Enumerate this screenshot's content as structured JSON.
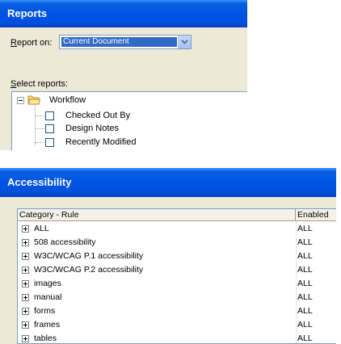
{
  "reports": {
    "title": "Reports",
    "report_on_label_accel": "R",
    "report_on_label_rest": "eport on:",
    "report_on_value": "Current Document",
    "select_reports_label_accel": "S",
    "select_reports_label_rest": "elect reports:",
    "tree": {
      "group": "Workflow",
      "items": [
        "Checked Out By",
        "Design Notes",
        "Recently Modified"
      ]
    }
  },
  "accessibility": {
    "title": "Accessibility",
    "columns": [
      "Category - Rule",
      "Enabled"
    ],
    "rows": [
      {
        "rule": "ALL",
        "enabled": "ALL"
      },
      {
        "rule": "508 accessibility",
        "enabled": "ALL"
      },
      {
        "rule": "W3C/WCAG P.1 accessibility",
        "enabled": "ALL"
      },
      {
        "rule": "W3C/WCAG P.2 accessibility",
        "enabled": "ALL"
      },
      {
        "rule": "images",
        "enabled": "ALL"
      },
      {
        "rule": "manual",
        "enabled": "ALL"
      },
      {
        "rule": "forms",
        "enabled": "ALL"
      },
      {
        "rule": "frames",
        "enabled": "ALL"
      },
      {
        "rule": "tables",
        "enabled": "ALL"
      }
    ]
  },
  "colors": {
    "title_bar": "#0054e3",
    "panel_bg": "#ece9d8",
    "selection": "#316ac5"
  }
}
